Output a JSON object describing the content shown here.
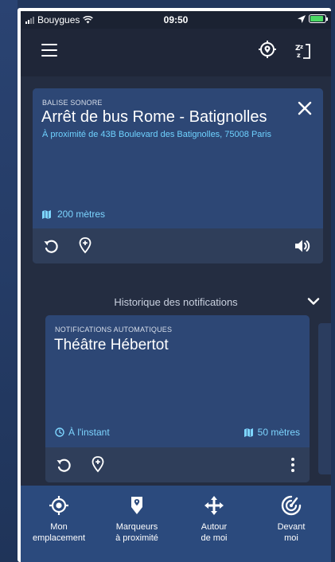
{
  "status_bar": {
    "carrier": "Bouygues",
    "time": "09:50"
  },
  "beacon_card": {
    "label": "BALISE SONORE",
    "title": "Arrêt de bus Rome - Batignolles",
    "subtitle": "À proximité de 43B Boulevard des Batignolles, 75008 Paris",
    "distance": "200 mètres"
  },
  "history": {
    "title": "Historique des notifications",
    "card": {
      "label": "NOTIFICATIONS AUTOMATIQUES",
      "title": "Théâtre Hébertot",
      "time": "À l'instant",
      "distance": "50 mètres"
    }
  },
  "bottom_nav": {
    "items": [
      {
        "label": "Mon\nemplacement",
        "icon": "locate-icon"
      },
      {
        "label": "Marqueurs\nà proximité",
        "icon": "marker-icon"
      },
      {
        "label": "Autour\nde moi",
        "icon": "arrows-icon"
      },
      {
        "label": "Devant\nmoi",
        "icon": "ahead-icon"
      }
    ]
  },
  "colors": {
    "card_background": "#2d4775",
    "accent_blue": "#6fd2ff",
    "screen_background": "#242d41",
    "bottom_nav": "#2b4a7d"
  }
}
